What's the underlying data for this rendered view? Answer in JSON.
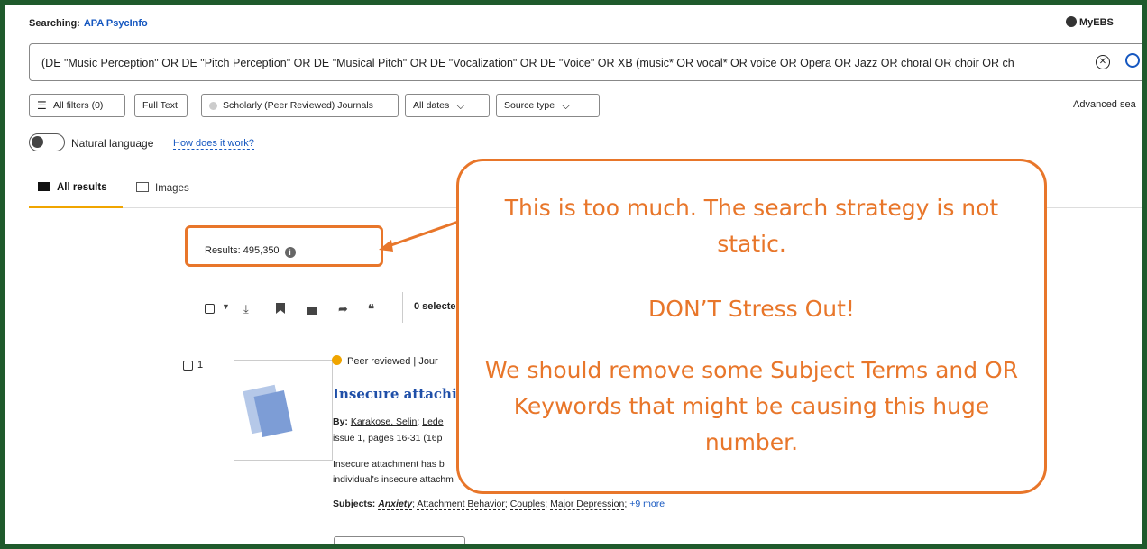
{
  "header": {
    "searching_label": "Searching:",
    "database": "APA PsycInfo",
    "account": "MyEBS"
  },
  "search": {
    "query": "(DE \"Music Perception\" OR DE \"Pitch Perception\" OR DE \"Musical Pitch\" OR DE \"Vocalization\" OR DE \"Voice\" OR XB (music* OR vocal* OR voice OR Opera OR Jazz OR choral OR choir OR ch"
  },
  "filters": {
    "all_filters": "All filters (0)",
    "full_text": "Full Text",
    "scholarly": "Scholarly (Peer Reviewed) Journals",
    "all_dates": "All dates",
    "source_type": "Source type",
    "advanced": "Advanced sea"
  },
  "natural_language": {
    "label": "Natural language",
    "how_link": "How does it work?"
  },
  "tabs": [
    {
      "label": "All results",
      "icon": "book-icon"
    },
    {
      "label": "Images",
      "icon": "image-icon"
    }
  ],
  "results": {
    "count_text": "Results: 495,350",
    "selected_text": "0 selecte"
  },
  "item": {
    "number": "1",
    "peer_reviewed": "Peer reviewed",
    "source_partial": "Jour",
    "title": "Insecure attachi",
    "by_label": "By:",
    "authors": [
      "Karakose, Selin",
      "Lede"
    ],
    "issue": "issue 1, pages 16-31 (16p",
    "abstract_line1": "Insecure attachment has b",
    "abstract_line2": "individual's insecure attachm",
    "subjects_label": "Subjects:",
    "subjects": [
      "Anxiety",
      "Attachment Behavior",
      "Couples",
      "Major Depression"
    ],
    "subjects_more": "+9 more"
  },
  "callout": {
    "line1": "This is too much. The search strategy is not static.",
    "line2": "DON’T Stress Out!",
    "line3": "We should remove some Subject Terms and OR Keywords that might be causing this huge number.",
    "color": "#e8762a"
  }
}
